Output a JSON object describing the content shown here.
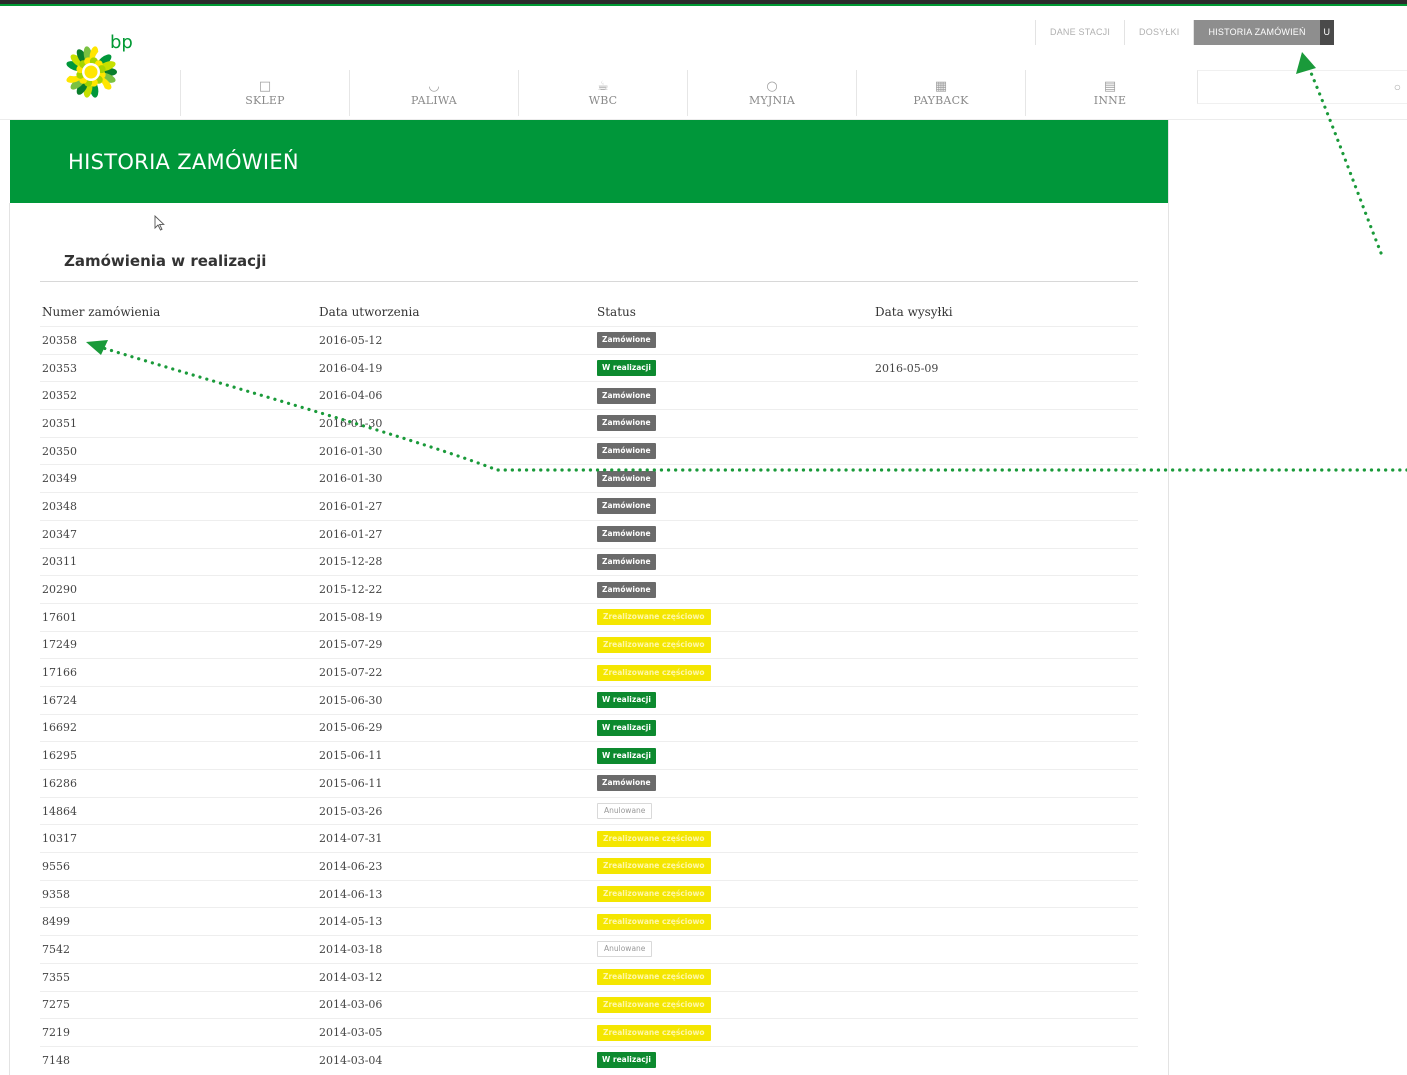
{
  "brand": {
    "logo_text": "bp",
    "green": "#009933"
  },
  "nav": {
    "items": [
      {
        "label": "SKLEP",
        "icon": "bag-icon"
      },
      {
        "label": "PALIWA",
        "icon": "gauge-icon"
      },
      {
        "label": "WBC",
        "icon": "cup-icon"
      },
      {
        "label": "MYJNIA",
        "icon": "drop-icon"
      },
      {
        "label": "PAYBACK",
        "icon": "grid-icon"
      },
      {
        "label": "INNE",
        "icon": "book-icon"
      }
    ]
  },
  "subnav": {
    "items": [
      {
        "label": "DANE STACJI",
        "active": false
      },
      {
        "label": "DOSYŁKI",
        "active": false
      },
      {
        "label": "HISTORIA ZAMÓWIEŃ",
        "active": true
      }
    ],
    "extra": "U"
  },
  "banner": {
    "title": "HISTORIA ZAMÓWIEŃ"
  },
  "section": {
    "title": "Zamówienia w realizacji"
  },
  "table": {
    "headers": [
      "Numer zamówienia",
      "Data utworzenia",
      "Status",
      "Data wysyłki"
    ],
    "rows": [
      {
        "number": "20358",
        "created": "2016-05-12",
        "status": "Zamówione",
        "status_type": "grey",
        "shipped": ""
      },
      {
        "number": "20353",
        "created": "2016-04-19",
        "status": "W realizacji",
        "status_type": "green",
        "shipped": "2016-05-09"
      },
      {
        "number": "20352",
        "created": "2016-04-06",
        "status": "Zamówione",
        "status_type": "grey",
        "shipped": ""
      },
      {
        "number": "20351",
        "created": "2016-01-30",
        "status": "Zamówione",
        "status_type": "grey",
        "shipped": ""
      },
      {
        "number": "20350",
        "created": "2016-01-30",
        "status": "Zamówione",
        "status_type": "grey",
        "shipped": ""
      },
      {
        "number": "20349",
        "created": "2016-01-30",
        "status": "Zamówione",
        "status_type": "grey",
        "shipped": ""
      },
      {
        "number": "20348",
        "created": "2016-01-27",
        "status": "Zamówione",
        "status_type": "grey",
        "shipped": ""
      },
      {
        "number": "20347",
        "created": "2016-01-27",
        "status": "Zamówione",
        "status_type": "grey",
        "shipped": ""
      },
      {
        "number": "20311",
        "created": "2015-12-28",
        "status": "Zamówione",
        "status_type": "grey",
        "shipped": ""
      },
      {
        "number": "20290",
        "created": "2015-12-22",
        "status": "Zamówione",
        "status_type": "grey",
        "shipped": ""
      },
      {
        "number": "17601",
        "created": "2015-08-19",
        "status": "Zrealizowane częściowo",
        "status_type": "yellow",
        "shipped": ""
      },
      {
        "number": "17249",
        "created": "2015-07-29",
        "status": "Zrealizowane częściowo",
        "status_type": "yellow",
        "shipped": ""
      },
      {
        "number": "17166",
        "created": "2015-07-22",
        "status": "Zrealizowane częściowo",
        "status_type": "yellow",
        "shipped": ""
      },
      {
        "number": "16724",
        "created": "2015-06-30",
        "status": "W realizacji",
        "status_type": "green",
        "shipped": ""
      },
      {
        "number": "16692",
        "created": "2015-06-29",
        "status": "W realizacji",
        "status_type": "green",
        "shipped": ""
      },
      {
        "number": "16295",
        "created": "2015-06-11",
        "status": "W realizacji",
        "status_type": "green",
        "shipped": ""
      },
      {
        "number": "16286",
        "created": "2015-06-11",
        "status": "Zamówione",
        "status_type": "grey",
        "shipped": ""
      },
      {
        "number": "14864",
        "created": "2015-03-26",
        "status": "Anulowane",
        "status_type": "outline",
        "shipped": ""
      },
      {
        "number": "10317",
        "created": "2014-07-31",
        "status": "Zrealizowane częściowo",
        "status_type": "yellow",
        "shipped": ""
      },
      {
        "number": "9556",
        "created": "2014-06-23",
        "status": "Zrealizowane częściowo",
        "status_type": "yellow",
        "shipped": ""
      },
      {
        "number": "9358",
        "created": "2014-06-13",
        "status": "Zrealizowane częściowo",
        "status_type": "yellow",
        "shipped": ""
      },
      {
        "number": "8499",
        "created": "2014-05-13",
        "status": "Zrealizowane częściowo",
        "status_type": "yellow",
        "shipped": ""
      },
      {
        "number": "7542",
        "created": "2014-03-18",
        "status": "Anulowane",
        "status_type": "outline",
        "shipped": ""
      },
      {
        "number": "7355",
        "created": "2014-03-12",
        "status": "Zrealizowane częściowo",
        "status_type": "yellow",
        "shipped": ""
      },
      {
        "number": "7275",
        "created": "2014-03-06",
        "status": "Zrealizowane częściowo",
        "status_type": "yellow",
        "shipped": ""
      },
      {
        "number": "7219",
        "created": "2014-03-05",
        "status": "Zrealizowane częściowo",
        "status_type": "yellow",
        "shipped": ""
      },
      {
        "number": "7148",
        "created": "2014-03-04",
        "status": "W realizacji",
        "status_type": "green",
        "shipped": ""
      }
    ]
  },
  "status_colors": {
    "grey": "#6b6b6b",
    "green": "#0d8a2f",
    "yellow": "#f4e600",
    "outline": "#d9d9d9"
  },
  "annotation_color": "#1a9a3a"
}
